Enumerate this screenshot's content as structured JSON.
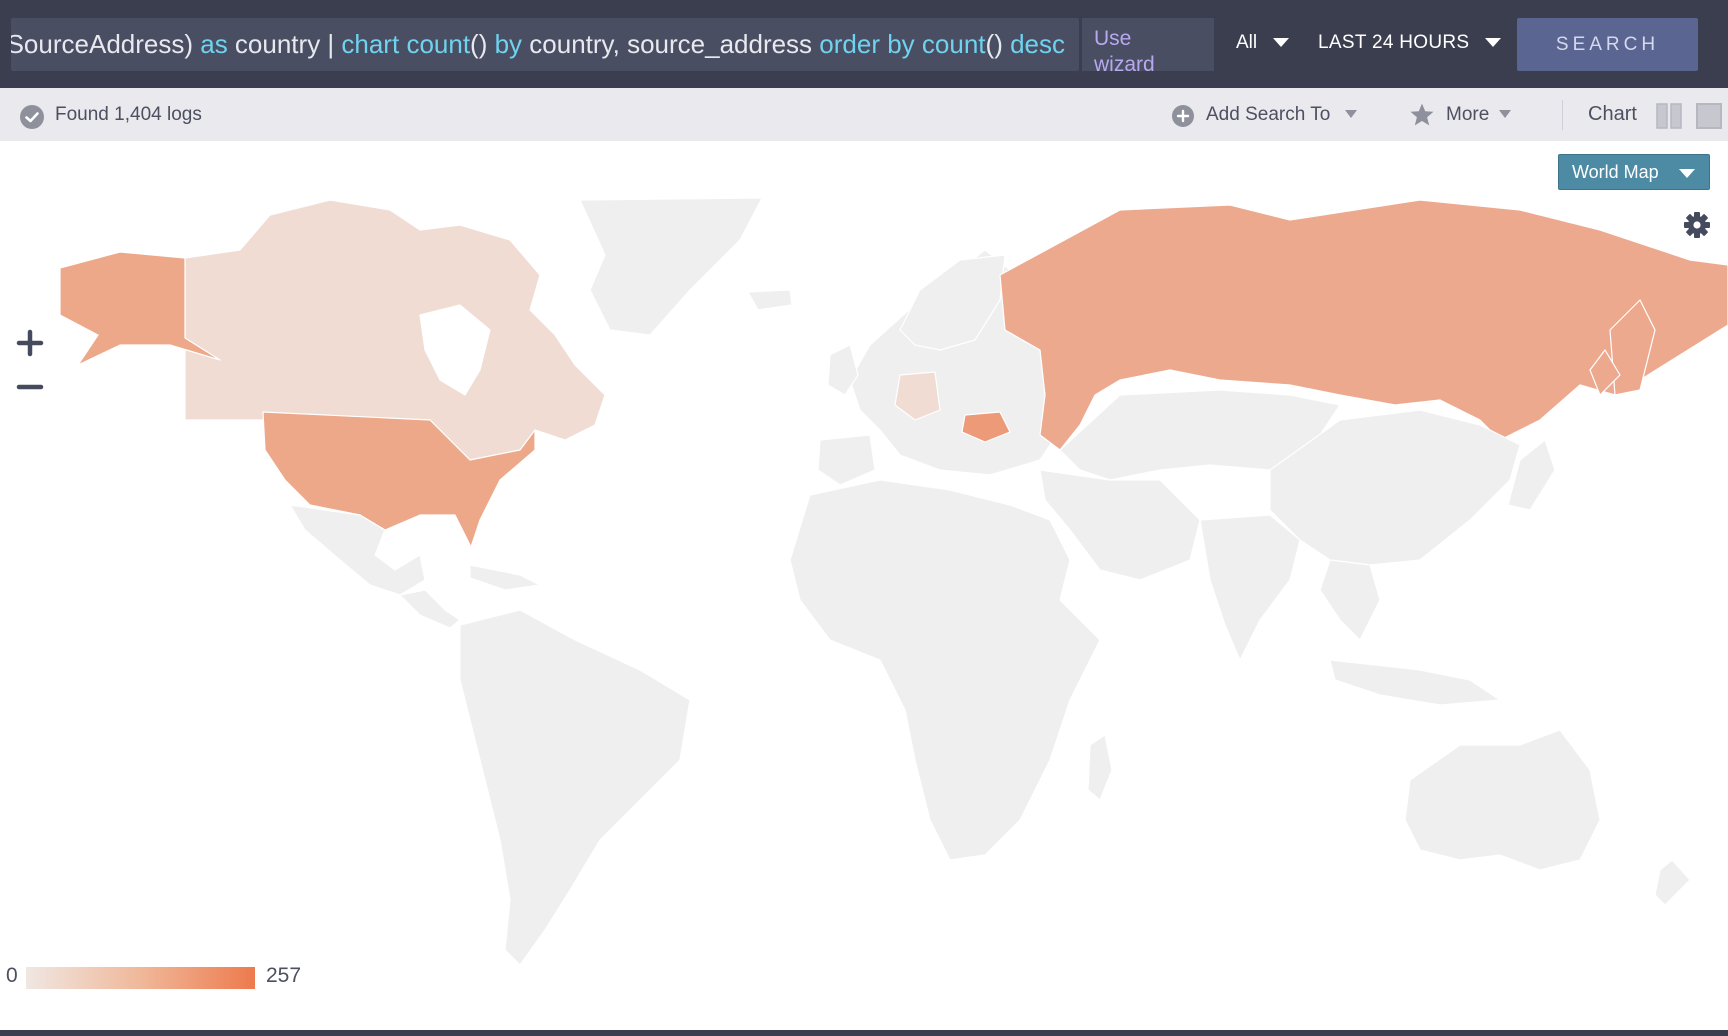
{
  "query": {
    "parts": [
      {
        "text": "SourceAddress)",
        "kw": false
      },
      {
        "text": " as",
        "kw": true
      },
      {
        "text": " country | ",
        "kw": false
      },
      {
        "text": "chart",
        "kw": true
      },
      {
        "text": " ",
        "kw": false
      },
      {
        "text": "count",
        "kw": true
      },
      {
        "text": "() ",
        "kw": false
      },
      {
        "text": "by",
        "kw": true
      },
      {
        "text": " country, source_address ",
        "kw": false
      },
      {
        "text": "order by",
        "kw": true
      },
      {
        "text": " ",
        "kw": false
      },
      {
        "text": "count",
        "kw": true
      },
      {
        "text": "() ",
        "kw": false
      },
      {
        "text": "desc",
        "kw": true
      }
    ]
  },
  "topbar": {
    "wizard_label": "Use wizard",
    "scope_label": "All",
    "time_range_label": "LAST 24 HOURS",
    "search_label": "SEARCH"
  },
  "toolbar": {
    "found_label": "Found 1,404 logs",
    "add_search_label": "Add Search To",
    "more_label": "More",
    "chart_label": "Chart"
  },
  "visualization": {
    "type_label": "World Map"
  },
  "legend": {
    "min": "0",
    "max": "257"
  },
  "colors": {
    "topbar": "#3b3e4f",
    "keyword": "#6fd3f0",
    "search_button": "#5b6591",
    "land_default": "#efefef",
    "scale_low": "#f0e7e3",
    "scale_high": "#ed7a4d"
  }
}
